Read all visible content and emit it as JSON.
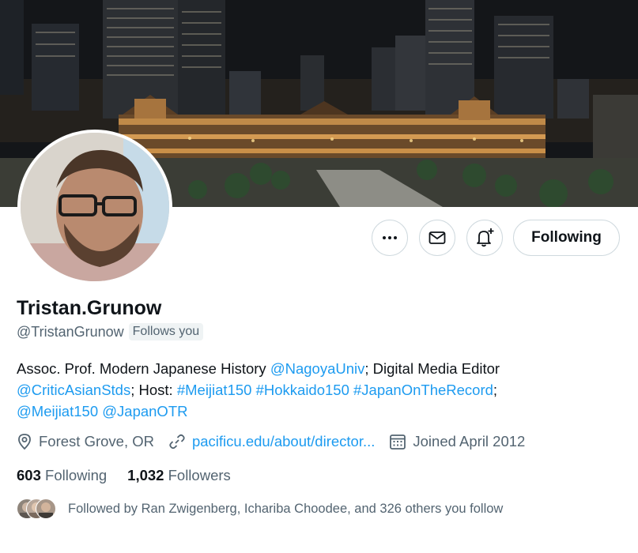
{
  "profile": {
    "display_name": "Tristan.Grunow",
    "handle": "@TristanGrunow",
    "follows_you_badge": "Follows you",
    "bio": {
      "t1": "Assoc. Prof. Modern Japanese History ",
      "l1": "@NagoyaUniv",
      "t2": "; Digital Media Editor ",
      "l2": "@CriticAsianStds",
      "t3": "; Host: ",
      "l3": "#Meijiat150",
      "t4": " ",
      "l4": "#Hokkaido150",
      "t5": " ",
      "l5": "#JapanOnTheRecord",
      "t6": ";",
      "l6": "@Meijiat150",
      "t7": " ",
      "l7": "@JapanOTR"
    },
    "location": "Forest Grove, OR",
    "website": "pacificu.edu/about/director...",
    "joined": "Joined April 2012",
    "following_count": "603",
    "following_label": "Following",
    "followers_count": "1,032",
    "followers_label": "Followers",
    "followed_by": "Followed by Ran Zwigenberg, Ichariba Choodee, and 326 others you follow"
  },
  "actions": {
    "more_icon": "more-horizontal-icon",
    "message_icon": "mail-icon",
    "notify_icon": "bell-plus-icon",
    "following_button": "Following"
  },
  "colors": {
    "link": "#1d9bf0",
    "secondary_text": "#536471",
    "primary_text": "#0f1419",
    "border": "#cfd9de"
  }
}
